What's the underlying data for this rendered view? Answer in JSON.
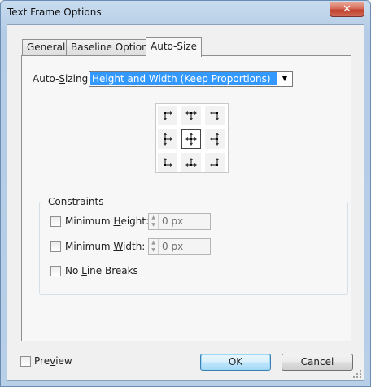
{
  "window": {
    "title": "Text Frame Options",
    "close_glyph": "✕"
  },
  "tabs": [
    {
      "label": "General",
      "active": false
    },
    {
      "label": "Baseline Options",
      "active": false
    },
    {
      "label": "Auto-Size",
      "active": true
    }
  ],
  "auto_sizing": {
    "label_prefix": "Auto-",
    "label_underlined": "S",
    "label_suffix": "izing",
    "value": "Height and Width (Keep Proportions)",
    "dropdown_glyph": "▼"
  },
  "reference_grid": {
    "selected": "center",
    "cells": [
      "top-left",
      "top-center",
      "top-right",
      "middle-left",
      "center",
      "middle-right",
      "bottom-left",
      "bottom-center",
      "bottom-right"
    ]
  },
  "constraints": {
    "legend": "Constraints",
    "min_height": {
      "label_prefix": "Minimum ",
      "label_underlined": "H",
      "label_suffix": "eight:",
      "checked": false,
      "value": "0 px"
    },
    "min_width": {
      "label_prefix": "Minimum ",
      "label_underlined": "W",
      "label_suffix": "idth:",
      "checked": false,
      "value": "0 px"
    },
    "no_line_breaks": {
      "label_prefix": "No ",
      "label_underlined": "L",
      "label_suffix": "ine Breaks",
      "checked": false
    }
  },
  "footer": {
    "preview": {
      "label_prefix": "Pre",
      "label_underlined": "v",
      "label_suffix": "iew",
      "checked": false
    },
    "ok_label": "OK",
    "cancel_label": "Cancel"
  },
  "colors": {
    "selection": "#3399ff",
    "default_button_border": "#3c7fb1"
  }
}
